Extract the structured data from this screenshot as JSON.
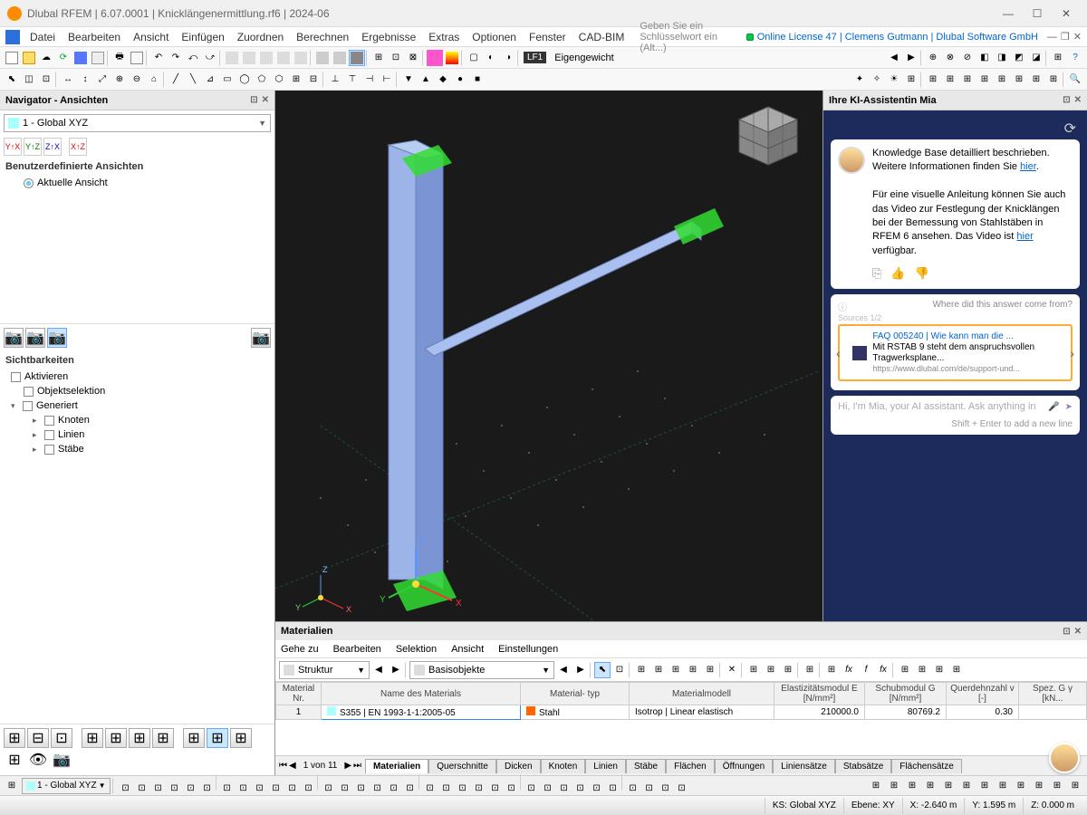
{
  "title": "Dlubal RFEM | 6.07.0001 | Knicklängenermittlung.rf6 | 2024-06",
  "menus": [
    "Datei",
    "Bearbeiten",
    "Ansicht",
    "Einfügen",
    "Zuordnen",
    "Berechnen",
    "Ergebnisse",
    "Extras",
    "Optionen",
    "Fenster",
    "CAD-BIM"
  ],
  "menu_search_placeholder": "Geben Sie ein Schlüsselwort ein (Alt...)",
  "license_text": "Online License 47 | Clemens Gutmann | Dlubal Software GmbH",
  "lf_code": "LF1",
  "lf_name": "Eigengewicht",
  "navigator": {
    "title": "Navigator - Ansichten",
    "view_combo": "1 - Global XYZ",
    "user_views_label": "Benutzerdefinierte Ansichten",
    "current_view": "Aktuelle Ansicht",
    "visibilities_label": "Sichtbarkeiten",
    "activate": "Aktivieren",
    "obj_selection": "Objektselektion",
    "generated": "Generiert",
    "nodes": "Knoten",
    "lines": "Linien",
    "members": "Stäbe"
  },
  "ai": {
    "title": "Ihre KI-Assistentin Mia",
    "msg1_p1": "Knowledge Base detailliert beschrieben. Weitere Informationen finden Sie ",
    "msg1_link1": "hier",
    "msg1_p2": "Für eine visuelle Anleitung können Sie auch das Video zur Festlegung der Knicklängen bei der Bemessung von Stahlstäben in RFEM 6 ansehen. Das Video ist ",
    "msg1_link2": "hier",
    "msg1_p3": " verfügbar.",
    "source_hdr": "Where did this answer come from?",
    "source_title": "FAQ 005240 | Wie kann man die ...",
    "source_snippet": "Mit RSTAB 9 steht dem anspruchsvollen Tragwerksplane...",
    "source_url": "https://www.dlubal.com/de/support-und...",
    "input_placeholder": "Hi, I'm Mia, your AI assistant. Ask anything in",
    "input_hint": "Shift + Enter to add a new line"
  },
  "materials": {
    "panel_title": "Materialien",
    "menus": [
      "Gehe zu",
      "Bearbeiten",
      "Selektion",
      "Ansicht",
      "Einstellungen"
    ],
    "combo1": "Struktur",
    "combo2": "Basisobjekte",
    "headers": {
      "nr": "Material\nNr.",
      "name": "Name des Materials",
      "type": "Material-\ntyp",
      "model": "Materialmodell",
      "e": "Elastizitätsmodul\nE [N/mm²]",
      "g": "Schubmodul\nG [N/mm²]",
      "v": "Querdehnzahl\nv [-]",
      "gamma": "Spez. G\nγ [kN..."
    },
    "row": {
      "nr": "1",
      "name": "S355 | EN 1993-1-1:2005-05",
      "type": "Stahl",
      "model": "Isotrop | Linear elastisch",
      "e": "210000.0",
      "g": "80769.2",
      "v": "0.30"
    },
    "pager": "1 von 11",
    "tabs": [
      "Materialien",
      "Querschnitte",
      "Dicken",
      "Knoten",
      "Linien",
      "Stäbe",
      "Flächen",
      "Öffnungen",
      "Liniensätze",
      "Stabsätze",
      "Flächensätze"
    ]
  },
  "status": {
    "combo": "1 - Global XYZ",
    "ks": "KS: Global XYZ",
    "plane": "Ebene: XY",
    "x": "X: -2.640 m",
    "y": "Y: 1.595 m",
    "z": "Z: 0.000 m"
  }
}
